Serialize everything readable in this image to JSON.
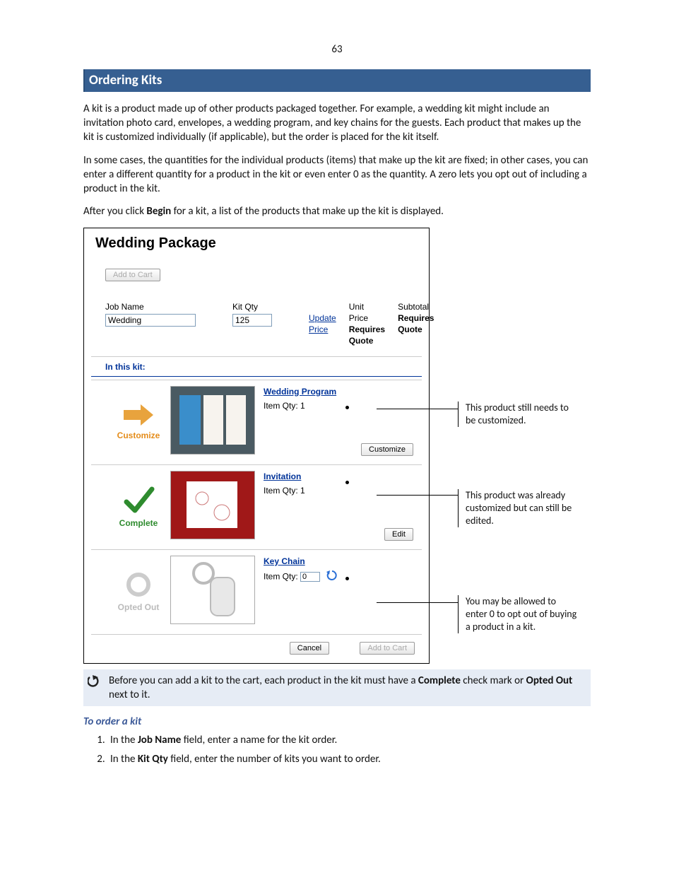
{
  "page_number": "63",
  "section_title": "Ordering Kits",
  "intro_para_1": "A kit is a product made up of other products packaged together. For example, a wedding kit might include an invitation photo card, envelopes, a wedding program, and key chains for the guests. Each product that makes up the kit is customized individually (if applicable), but the order is placed for the kit itself.",
  "intro_para_2": "In some cases, the quantities for the individual products (items) that make up the kit are fixed; in other cases, you can enter a different quantity for a product in the kit or even enter 0 as the quantity. A zero lets you opt out of including a product in the kit.",
  "intro_para_3_prefix": "After you click ",
  "intro_para_3_bold": "Begin",
  "intro_para_3_suffix": " for a kit, a list of the products that make up the kit is displayed.",
  "screenshot": {
    "title": "Wedding Package",
    "add_to_cart_label": "Add to Cart",
    "job_name_label": "Job Name",
    "job_name_value": "Wedding",
    "kit_qty_label": "Kit Qty",
    "kit_qty_value": "125",
    "update_price_label": "Update Price",
    "unit_price_label": "Unit Price",
    "unit_price_value": "Requires Quote",
    "subtotal_label": "Subtotal",
    "subtotal_value": "Requires Quote",
    "in_this_kit_label": "In this kit:",
    "items": [
      {
        "status_label": "Customize",
        "name": "Wedding Program",
        "item_qty_label": "Item Qty:",
        "item_qty_value": "1",
        "action_label": "Customize"
      },
      {
        "status_label": "Complete",
        "name": "Invitation",
        "item_qty_label": "Item Qty:",
        "item_qty_value": "1",
        "action_label": "Edit"
      },
      {
        "status_label": "Opted Out",
        "name": "Key Chain",
        "item_qty_label": "Item Qty:",
        "item_qty_value": "0"
      }
    ],
    "cancel_label": "Cancel"
  },
  "callouts": {
    "c1": "This product still needs to be customized.",
    "c2": "This product was already customized but can still be edited.",
    "c3": "You may be allowed to enter 0 to opt out of buying a product in a kit."
  },
  "note": {
    "prefix": "Before you can add a kit to the cart, each product in the kit must have a ",
    "bold1": "Complete",
    "mid": " check mark or ",
    "bold2": "Opted Out",
    "suffix": " next to it."
  },
  "subhead": "To order a kit",
  "steps": {
    "s1_prefix": "In the ",
    "s1_bold": "Job Name",
    "s1_suffix": " field, enter a name for the kit order.",
    "s2_prefix": "In the ",
    "s2_bold": "Kit Qty",
    "s2_suffix": " field, enter the number of kits you want to order."
  }
}
